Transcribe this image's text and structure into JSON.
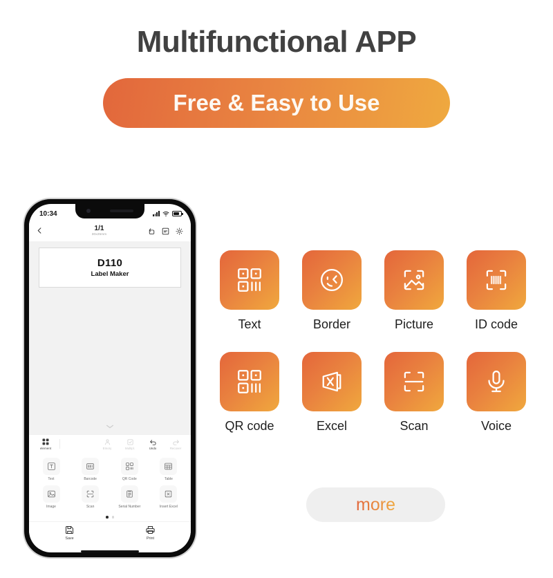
{
  "header": {
    "headline": "Multifunctional APP",
    "pill_label": "Free & Easy to Use"
  },
  "colors": {
    "gradient_start": "#e2673c",
    "gradient_end": "#efa93f",
    "headline_color": "#414141",
    "tile_label_color": "#1d1d1d",
    "more_button_bg": "#efefef",
    "phone_canvas_bg": "#f2f2f2"
  },
  "phone": {
    "status": {
      "time": "10:34",
      "signal_icon": "cellular-signal-icon",
      "wifi_icon": "wifi-icon",
      "battery_icon": "battery-icon"
    },
    "app_header": {
      "back_icon": "chevron-left-icon",
      "page_indicator": "1/1",
      "label_size": "30x25mm",
      "actions": [
        {
          "name": "rotate-icon",
          "label": "Rotate"
        },
        {
          "name": "template-icon",
          "label": "Template"
        },
        {
          "name": "gear-icon",
          "label": "Settings"
        }
      ]
    },
    "canvas": {
      "label_title": "D110",
      "label_subtitle": "Label Maker",
      "collapse_icon": "chevron-down-icon"
    },
    "toolbar": {
      "element_label": "element",
      "element_icon": "grid-icon",
      "items": [
        {
          "label": "Emory",
          "icon": "emoji-icon",
          "active": false
        },
        {
          "label": "Multipl.",
          "icon": "multiple-select-icon",
          "active": false
        },
        {
          "label": "Undo",
          "icon": "undo-icon",
          "active": true
        },
        {
          "label": "Recover",
          "icon": "redo-icon",
          "active": false
        }
      ]
    },
    "tool_grid": {
      "rows": [
        [
          {
            "label": "Text",
            "icon": "text-box-icon"
          },
          {
            "label": "Barcode",
            "icon": "barcode-icon"
          },
          {
            "label": "QR Code",
            "icon": "qr-code-icon"
          },
          {
            "label": "Table",
            "icon": "table-icon"
          }
        ],
        [
          {
            "label": "Image",
            "icon": "image-icon"
          },
          {
            "label": "Scan",
            "icon": "scan-icon"
          },
          {
            "label": "Serial Number",
            "icon": "serial-number-icon"
          },
          {
            "label": "Insert Excel",
            "icon": "insert-excel-icon"
          }
        ]
      ],
      "page_dots": {
        "count": 2,
        "active_index": 0
      }
    },
    "bottom_bar": [
      {
        "label": "Save",
        "icon": "save-icon"
      },
      {
        "label": "Print",
        "icon": "printer-icon"
      }
    ]
  },
  "features": {
    "rows": [
      [
        {
          "label": "Text",
          "icon": "qr-code-icon"
        },
        {
          "label": "Border",
          "icon": "smiley-face-icon"
        },
        {
          "label": "Picture",
          "icon": "picture-frame-icon"
        },
        {
          "label": "ID code",
          "icon": "barcode-scan-icon"
        }
      ],
      [
        {
          "label": "QR code",
          "icon": "qr-code-icon"
        },
        {
          "label": "Excel",
          "icon": "excel-file-icon"
        },
        {
          "label": "Scan",
          "icon": "scan-frame-icon"
        },
        {
          "label": "Voice",
          "icon": "microphone-icon"
        }
      ]
    ],
    "more_label": "more"
  }
}
